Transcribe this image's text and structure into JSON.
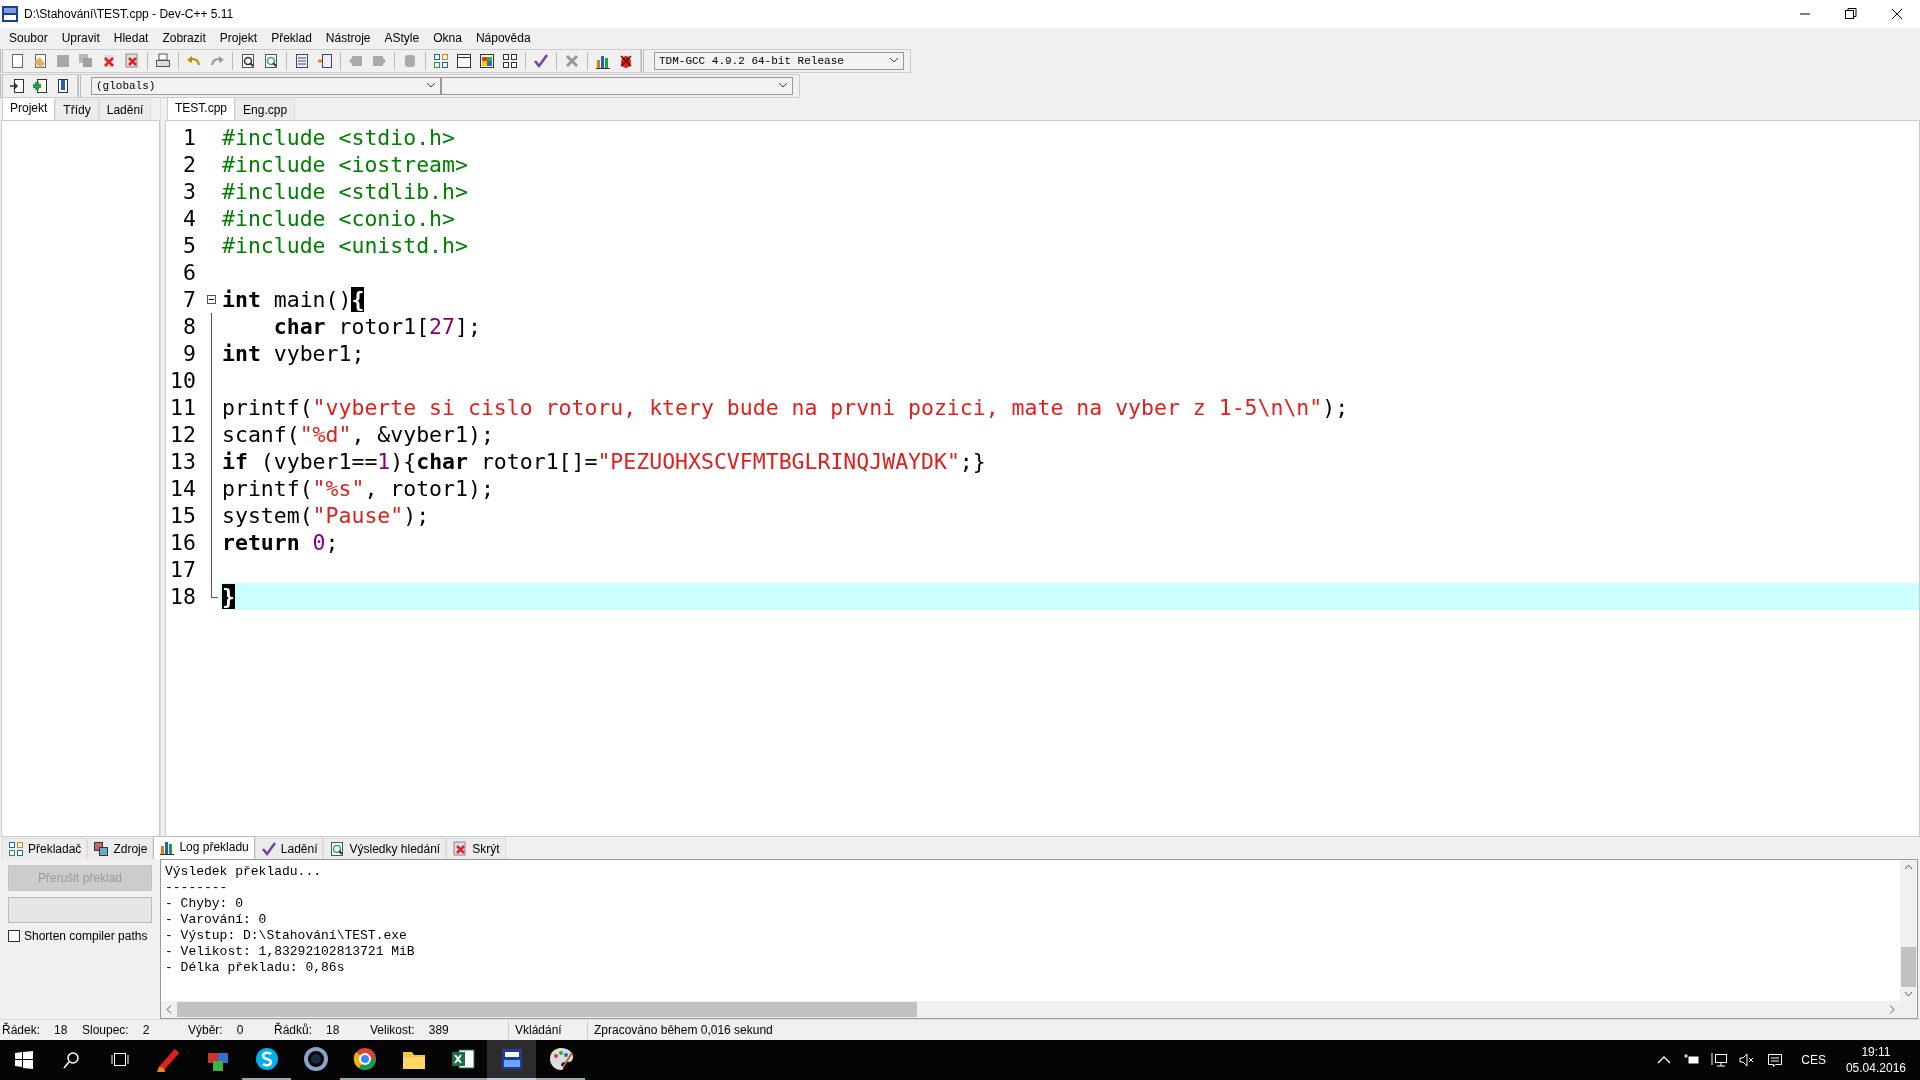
{
  "window": {
    "title": "D:\\Stahování\\TEST.cpp - Dev-C++ 5.11"
  },
  "menu": [
    "Soubor",
    "Upravit",
    "Hledat",
    "Zobrazit",
    "Projekt",
    "Překlad",
    "Nástroje",
    "AStyle",
    "Okna",
    "Nápověda"
  ],
  "toolbar": {
    "compiler": "TDM-GCC 4.9.2 64-bit Release",
    "scope": "(globals)"
  },
  "left_tabs": [
    {
      "label": "Projekt",
      "selected": true
    },
    {
      "label": "Třídy",
      "selected": false
    },
    {
      "label": "Ladění",
      "selected": false
    }
  ],
  "file_tabs": [
    {
      "label": "TEST.cpp",
      "selected": true
    },
    {
      "label": "Eng.cpp",
      "selected": false
    }
  ],
  "editor": {
    "lines": [
      {
        "number": "1",
        "current": false,
        "fold_marker": false,
        "in_fold": false,
        "tokens": [
          {
            "kind": "preprocessor",
            "text": "#include <stdio.h>"
          }
        ]
      },
      {
        "number": "2",
        "current": false,
        "fold_marker": false,
        "in_fold": false,
        "tokens": [
          {
            "kind": "preprocessor",
            "text": "#include <iostream>"
          }
        ]
      },
      {
        "number": "3",
        "current": false,
        "fold_marker": false,
        "in_fold": false,
        "tokens": [
          {
            "kind": "preprocessor",
            "text": "#include <stdlib.h>"
          }
        ]
      },
      {
        "number": "4",
        "current": false,
        "fold_marker": false,
        "in_fold": false,
        "tokens": [
          {
            "kind": "preprocessor",
            "text": "#include <conio.h>"
          }
        ]
      },
      {
        "number": "5",
        "current": false,
        "fold_marker": false,
        "in_fold": false,
        "tokens": [
          {
            "kind": "preprocessor",
            "text": "#include <unistd.h>"
          }
        ]
      },
      {
        "number": "6",
        "current": false,
        "fold_marker": false,
        "in_fold": false
      },
      {
        "number": "7",
        "current": false,
        "fold_marker": true,
        "in_fold": false,
        "tokens": [
          {
            "kind": "keyword",
            "text": "int"
          },
          {
            "kind": "plain",
            "text": " main()"
          },
          {
            "kind": "brace_match",
            "text": "{"
          }
        ]
      },
      {
        "number": "8",
        "current": false,
        "fold_marker": false,
        "in_fold": true,
        "indented": true,
        "tokens": [
          {
            "kind": "keyword",
            "text": "char"
          },
          {
            "kind": "plain",
            "text": " rotor1["
          },
          {
            "kind": "number",
            "text": "27"
          },
          {
            "kind": "plain",
            "text": "];"
          }
        ]
      },
      {
        "number": "9",
        "current": false,
        "fold_marker": false,
        "in_fold": true,
        "tokens": [
          {
            "kind": "keyword",
            "text": "int"
          },
          {
            "kind": "plain",
            "text": " vyber1;"
          }
        ]
      },
      {
        "number": "10",
        "current": false,
        "fold_marker": false,
        "in_fold": true
      },
      {
        "number": "11",
        "current": false,
        "fold_marker": false,
        "in_fold": true,
        "tokens": [
          {
            "kind": "plain",
            "text": "printf("
          },
          {
            "kind": "string",
            "text": "\"vyberte si cislo rotoru, ktery bude na prvni pozici, mate na vyber z 1-5\\n\\n\""
          },
          {
            "kind": "plain",
            "text": ");"
          }
        ]
      },
      {
        "number": "12",
        "current": false,
        "fold_marker": false,
        "in_fold": true,
        "tokens": [
          {
            "kind": "plain",
            "text": "scanf("
          },
          {
            "kind": "string",
            "text": "\"%d\""
          },
          {
            "kind": "plain",
            "text": ", &vyber1);"
          }
        ]
      },
      {
        "number": "13",
        "current": false,
        "fold_marker": false,
        "in_fold": true,
        "tokens": [
          {
            "kind": "keyword",
            "text": "if"
          },
          {
            "kind": "plain",
            "text": " (vyber1=="
          },
          {
            "kind": "number",
            "text": "1"
          },
          {
            "kind": "plain",
            "text": "){"
          },
          {
            "kind": "keyword",
            "text": "char"
          },
          {
            "kind": "plain",
            "text": " rotor1[]="
          },
          {
            "kind": "string",
            "text": "\"PEZUOHXSCVFMTBGLRINQJWAYDK\""
          },
          {
            "kind": "plain",
            "text": ";}"
          }
        ]
      },
      {
        "number": "14",
        "current": false,
        "fold_marker": false,
        "in_fold": true,
        "tokens": [
          {
            "kind": "plain",
            "text": "printf("
          },
          {
            "kind": "string",
            "text": "\"%s\""
          },
          {
            "kind": "plain",
            "text": ", rotor1);"
          }
        ]
      },
      {
        "number": "15",
        "current": false,
        "fold_marker": false,
        "in_fold": true,
        "tokens": [
          {
            "kind": "plain",
            "text": "system("
          },
          {
            "kind": "string",
            "text": "\"Pause\""
          },
          {
            "kind": "plain",
            "text": ");"
          }
        ]
      },
      {
        "number": "16",
        "current": false,
        "fold_marker": false,
        "in_fold": true,
        "tokens": [
          {
            "kind": "keyword",
            "text": "return"
          },
          {
            "kind": "number",
            "text": "0"
          },
          {
            "kind": "plain",
            "text": ";"
          }
        ]
      },
      {
        "number": "17",
        "current": false,
        "fold_marker": false,
        "in_fold": true
      },
      {
        "number": "18",
        "current": true,
        "fold_marker": false,
        "in_fold": true,
        "tokens": [
          {
            "kind": "brace_match",
            "text": "}"
          }
        ]
      }
    ]
  },
  "bottom_tabs": [
    {
      "label": "Překladač",
      "selected": false
    },
    {
      "label": "Zdroje",
      "selected": false
    },
    {
      "label": "Log překladu",
      "selected": true
    },
    {
      "label": "Ladění",
      "selected": false
    },
    {
      "label": "Výsledky hledání",
      "selected": false
    },
    {
      "label": "Skrýt",
      "selected": false
    }
  ],
  "abort_button": {
    "label": "Přerušit překlad",
    "disabled": true
  },
  "shorten_paths": {
    "label": "Shorten compiler paths",
    "checked": false
  },
  "log": [
    "Výsledek překladu...",
    "--------",
    "- Chyby: 0",
    "- Varování: 0",
    "- Výstup: D:\\Stahování\\TEST.exe",
    "- Velikost: 1,83292102813721 MiB",
    "- Délka překladu: 0,86s"
  ],
  "status_bar": {
    "fields": [
      {
        "label": "Řádek:",
        "value": "18"
      },
      {
        "label": "Sloupec:",
        "value": "2"
      },
      {
        "label": "Výběr:",
        "value": "0"
      },
      {
        "label": "Řádků:",
        "value": "18"
      },
      {
        "label": "Velikost:",
        "value": "389"
      }
    ],
    "mode": "Vkládání",
    "message": "Zpracováno během 0,016 sekund"
  },
  "taskbar": {
    "apps": [
      {
        "kind": "brush",
        "running": false,
        "selected": false
      },
      {
        "kind": "cubes",
        "running": false,
        "selected": false
      },
      {
        "kind": "s",
        "running": true,
        "selected": false
      },
      {
        "kind": "ring",
        "running": false,
        "selected": false
      },
      {
        "kind": "globe",
        "running": true,
        "selected": false
      },
      {
        "kind": "folder",
        "running": true,
        "selected": false
      },
      {
        "kind": "sheet",
        "running": true,
        "selected": false
      },
      {
        "kind": "dev",
        "running": true,
        "selected": true
      },
      {
        "kind": "palette",
        "running": true,
        "selected": false
      }
    ],
    "language": "CES",
    "time": "19:11",
    "date": "05.04.2016"
  }
}
